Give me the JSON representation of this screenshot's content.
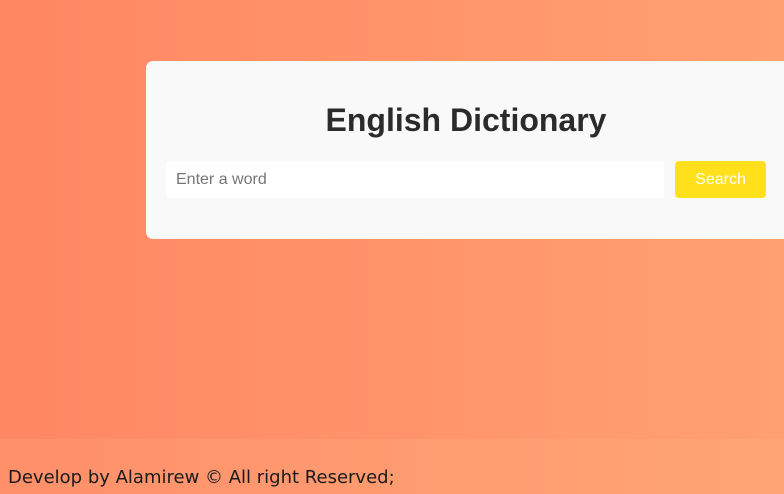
{
  "app": {
    "title": "English Dictionary"
  },
  "search": {
    "placeholder": "Enter a word",
    "value": "",
    "button_label": "Search"
  },
  "footer": {
    "text": "Develop by Alamirew © All right Reserved;"
  },
  "colors": {
    "background_start": "#ff8762",
    "background_end": "#ffa072",
    "card_background": "#f9f9f9",
    "button_background": "#ffe01b",
    "button_text": "#ffffff",
    "title_text": "#2b2b2b"
  }
}
